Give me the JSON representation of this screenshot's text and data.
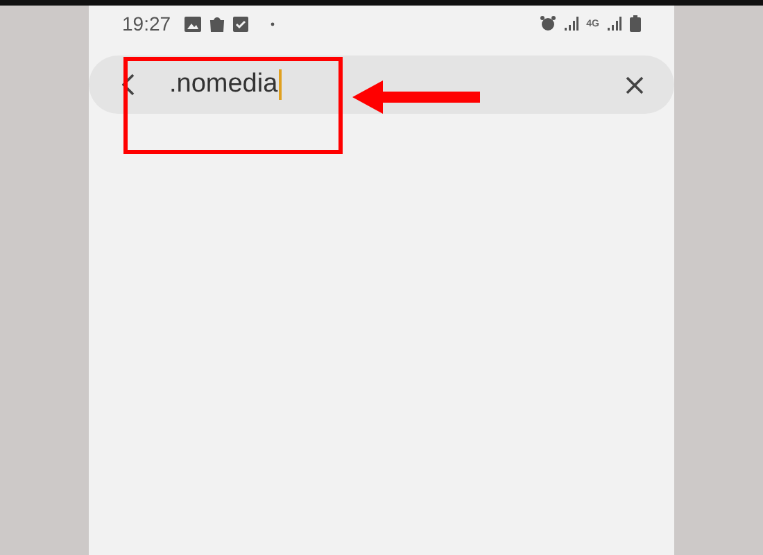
{
  "status_bar": {
    "time": "19:27",
    "network": "4G"
  },
  "search": {
    "value": ".nomedia",
    "focused": true
  },
  "annotation": {
    "color": "#ff0000"
  }
}
